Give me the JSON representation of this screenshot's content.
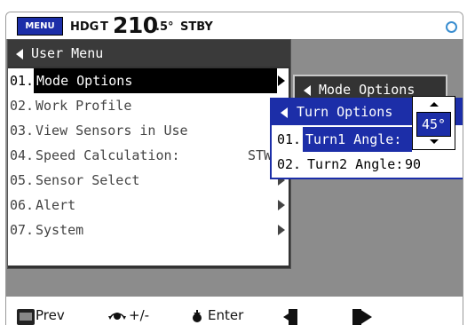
{
  "status_bar": {
    "menu_label": "MENU",
    "heading_label": "HDG",
    "heading_ref": "T",
    "heading_int": "210",
    "heading_dec": ".5°",
    "mode": "STBY",
    "gps_icon": "gps-status-icon"
  },
  "user_menu": {
    "title": "User Menu",
    "items": [
      {
        "num": "01.",
        "label": "Mode Options",
        "value": "",
        "has_submenu": true
      },
      {
        "num": "02.",
        "label": "Work Profile",
        "value": "",
        "has_submenu": false
      },
      {
        "num": "03.",
        "label": "View Sensors in Use",
        "value": "",
        "has_submenu": false
      },
      {
        "num": "04.",
        "label": "Speed Calculation:",
        "value": "STW",
        "has_submenu": false
      },
      {
        "num": "05.",
        "label": "Sensor Select",
        "value": "",
        "has_submenu": true
      },
      {
        "num": "06.",
        "label": "Alert",
        "value": "",
        "has_submenu": true
      },
      {
        "num": "07.",
        "label": "System",
        "value": "",
        "has_submenu": true
      }
    ]
  },
  "mode_options": {
    "title": "Mode Options"
  },
  "turn_options": {
    "title": "Turn Options",
    "items": [
      {
        "num": "01.",
        "label": "Turn1 Angle:",
        "value": "45°"
      },
      {
        "num": "02.",
        "label": "Turn2 Angle:",
        "value": "90"
      }
    ],
    "spinner_value": "45°"
  },
  "bottom_bar": {
    "prev_label": "Prev",
    "knob_label": "+/-",
    "enter_label": "Enter",
    "icons": [
      "menu-esc-icon",
      "rotary-knob-icon",
      "enter-knob-icon",
      "left-arrow-icon",
      "right-arrow-icon"
    ]
  },
  "colors": {
    "accent_blue": "#1c2ea8",
    "panel_dark": "#333333",
    "background_gray": "#8c8c8c",
    "gps_blue": "#3a8ed0"
  }
}
